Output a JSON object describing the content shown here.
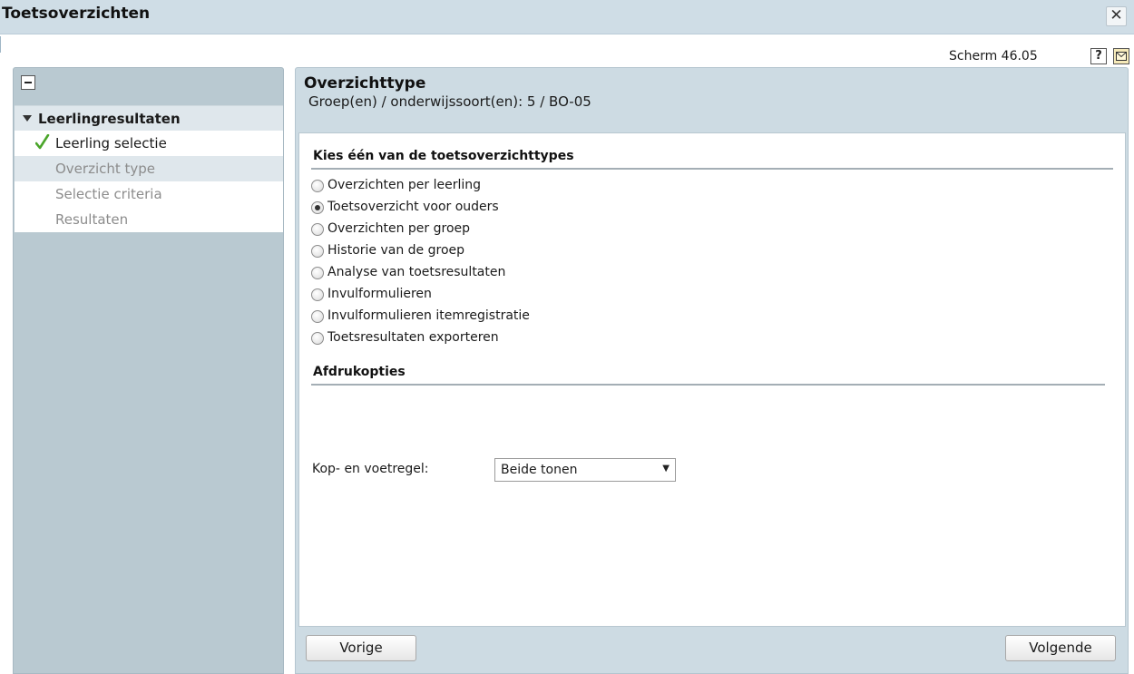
{
  "window": {
    "title": "Toetsoverzichten"
  },
  "toolbar": {
    "screen_label": "Scherm 46.05",
    "help_label": "?",
    "icons": [
      "help-icon",
      "mail-icon",
      "close-icon"
    ]
  },
  "sidebar": {
    "group": "Leerlingresultaten",
    "items": [
      {
        "label": "Leerling selectie",
        "state": "done"
      },
      {
        "label": "Overzicht type",
        "state": "active"
      },
      {
        "label": "Selectie criteria",
        "state": "pending"
      },
      {
        "label": "Resultaten",
        "state": "pending"
      }
    ]
  },
  "main": {
    "title": "Overzichttype",
    "subtitle": "Groep(en) / onderwijssoort(en): 5 / BO-05",
    "types_section": "Kies één van de toetsoverzichttypes",
    "types": [
      {
        "label": "Overzichten per leerling",
        "checked": false
      },
      {
        "label": "Toetsoverzicht voor ouders",
        "checked": true
      },
      {
        "label": "Overzichten per groep",
        "checked": false
      },
      {
        "label": "Historie van de groep",
        "checked": false
      },
      {
        "label": "Analyse van toetsresultaten",
        "checked": false
      },
      {
        "label": "Invulformulieren",
        "checked": false
      },
      {
        "label": "Invulformulieren itemregistratie",
        "checked": false
      },
      {
        "label": "Toetsresultaten exporteren",
        "checked": false
      }
    ],
    "print_section": "Afdrukopties",
    "header_footer_label": "Kop- en voetregel:",
    "header_footer_value": "Beide tonen"
  },
  "footer": {
    "prev_label": "Vorige",
    "next_label": "Volgende"
  },
  "colors": {
    "accent": "#cddbe3",
    "sidebar": "#b9c9d1",
    "check": "#4aa52a"
  }
}
